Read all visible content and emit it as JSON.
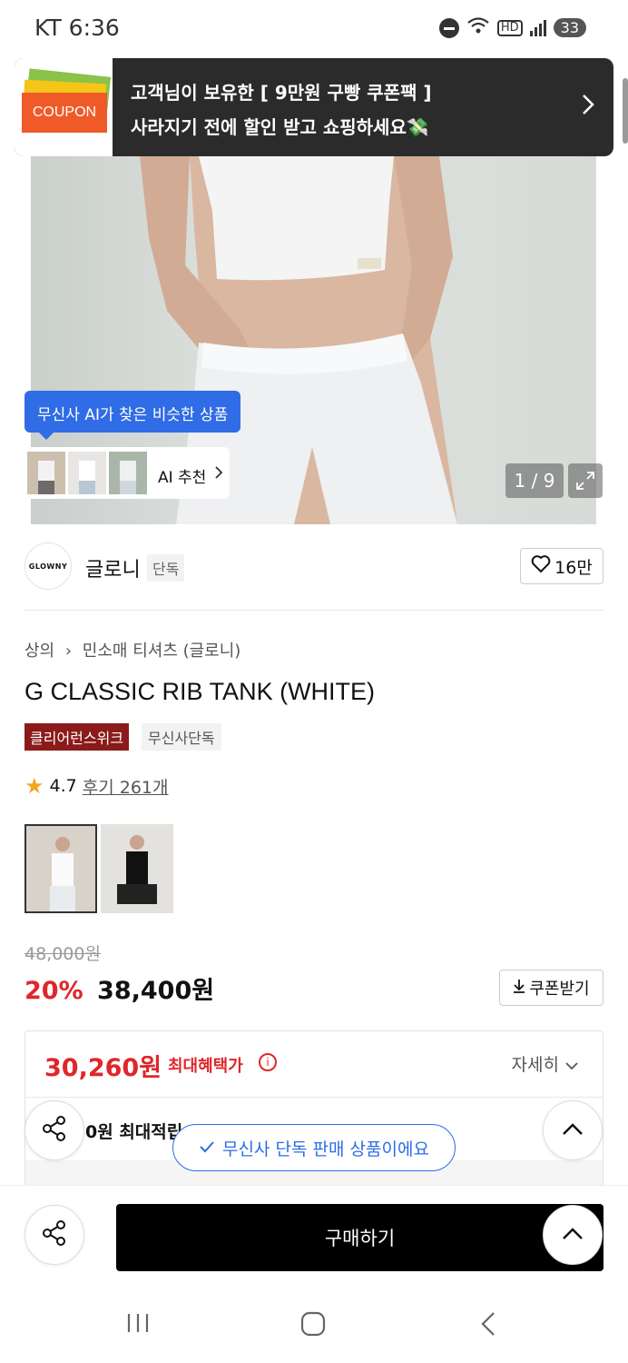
{
  "status_bar": {
    "carrier_time": "KT 6:36",
    "battery": "33",
    "hd": "HD"
  },
  "coupon_banner": {
    "tag_text": "COUPON",
    "line1": "고객님이 보유한 [ 9만원 구빵 쿠폰팩 ]",
    "line2": "사라지기 전에 할인 받고 쇼핑하세요💸"
  },
  "ai": {
    "bubble": "무신사 AI가 찾은 비슷한 상품",
    "recommend": "AI 추천"
  },
  "gallery": {
    "pager": "1 / 9"
  },
  "brand": {
    "logo": "GLOWNY",
    "name": "글로니",
    "badge": "단독",
    "likes": "16만"
  },
  "breadcrumb": {
    "category": "상의",
    "subcategory": "민소매 티셔츠 (글로니)"
  },
  "product": {
    "title": "G CLASSIC RIB TANK (WHITE)",
    "tags": [
      "클리어런스위크",
      "무신사단독"
    ],
    "rating": "4.7",
    "reviews": "후기 261개"
  },
  "price": {
    "original": "48,000원",
    "discount": "20%",
    "sale": "38,400원",
    "coupon_button": "쿠폰받기"
  },
  "benefit": {
    "best_price": "30,260원",
    "best_label": "최대혜택가",
    "detail": "자세히",
    "points": "0원 최대적립"
  },
  "toast": "무신사 단독 판매 상품이에요",
  "buy_button": "구매하기",
  "colors": {
    "accent_red": "#e0262a",
    "brand_blue": "#2f6ce5",
    "coupon_orange": "#f05a28"
  }
}
